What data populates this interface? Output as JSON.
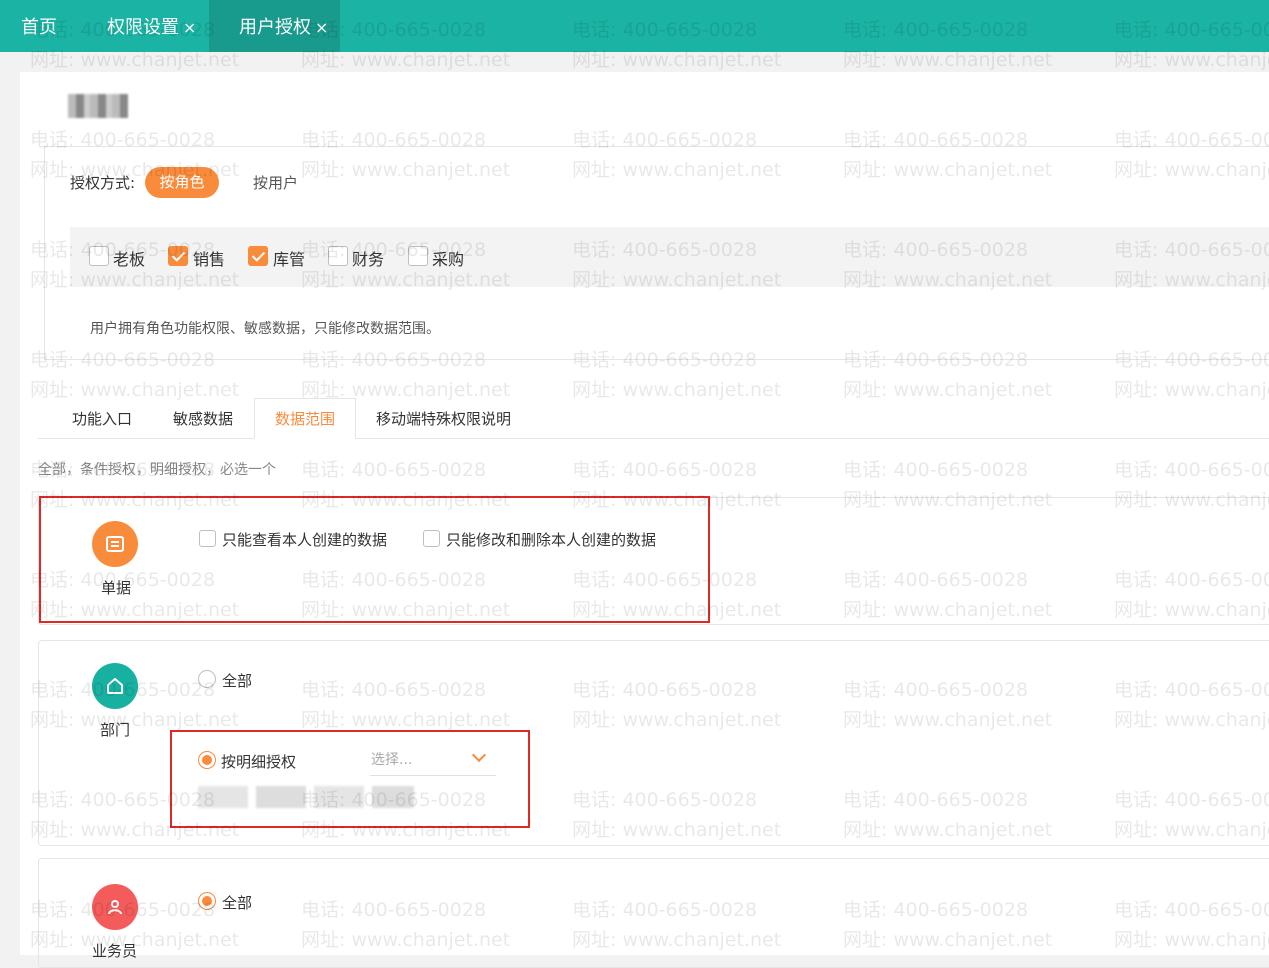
{
  "tabs": [
    {
      "label": "首页"
    },
    {
      "label": "权限设置"
    },
    {
      "label": "用户授权"
    }
  ],
  "close_glyph": "×",
  "auth": {
    "method_label": "授权方式:",
    "by_role": "按角色",
    "by_user": "按用户",
    "roles": [
      {
        "label": "老板",
        "checked": false
      },
      {
        "label": "销售",
        "checked": true
      },
      {
        "label": "库管",
        "checked": true
      },
      {
        "label": "财务",
        "checked": false
      },
      {
        "label": "采购",
        "checked": false
      }
    ],
    "note": "用户拥有角色功能权限、敏感数据，只能修改数据范围。"
  },
  "subtabs": {
    "func": "功能入口",
    "sensitive": "敏感数据",
    "scope": "数据范围",
    "mobile": "移动端特殊权限说明"
  },
  "hint": "全部，条件授权，明细授权，必选一个",
  "sections": {
    "doc": {
      "label": "单据",
      "opt1": "只能查看本人创建的数据",
      "opt2": "只能修改和删除本人创建的数据"
    },
    "dept": {
      "label": "部门",
      "all": "全部",
      "detail": "按明细授权",
      "select_placeholder": "选择..."
    },
    "sales": {
      "label": "业务员",
      "all": "全部"
    }
  },
  "icons": {
    "doc": "document-icon",
    "dept": "home-icon",
    "sales": "person-icon",
    "chevron": "chevron-down-icon"
  },
  "colors": {
    "header": "#1bb3a3",
    "accent": "#f88b3c",
    "highlight": "#e22727"
  },
  "watermark": {
    "phone": "电话: 400-665-0028",
    "site": "网址: www.chanjet.net"
  }
}
